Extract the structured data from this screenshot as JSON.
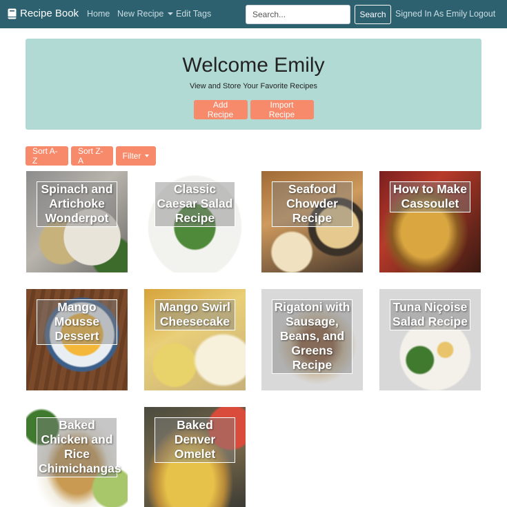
{
  "nav": {
    "brand": "Recipe Book",
    "home": "Home",
    "new_recipe": "New Recipe",
    "edit_tags": "Edit Tags",
    "search_placeholder": "Search...",
    "search_button": "Search",
    "signed_in": "Signed In As Emily",
    "logout": "Logout"
  },
  "hero": {
    "title": "Welcome Emily",
    "subtitle": "View and Store Your Favorite Recipes",
    "add_recipe": "Add Recipe",
    "import_recipe": "Import Recipe"
  },
  "toolbar": {
    "sort_az": "Sort A-Z",
    "sort_za": "Sort Z-A",
    "filter": "Filter"
  },
  "recipes": [
    {
      "title": "Spinach and Artichoke Wonderpot"
    },
    {
      "title": "Classic Caesar Salad Recipe"
    },
    {
      "title": "Seafood Chowder Recipe"
    },
    {
      "title": "How to Make Cassoulet"
    },
    {
      "title": "Mango Mousse Dessert"
    },
    {
      "title": "Mango Swirl Cheesecake"
    },
    {
      "title": "Rigatoni with Sausage, Beans, and Greens Recipe"
    },
    {
      "title": "Tuna Niçoise Salad Recipe"
    },
    {
      "title": "Baked Chicken and Rice Chimichangas"
    },
    {
      "title": "Baked Denver Omelet"
    }
  ],
  "colors": {
    "navbar": "#2e6170",
    "hero": "#b2dad5",
    "accent": "#f68a6b"
  }
}
